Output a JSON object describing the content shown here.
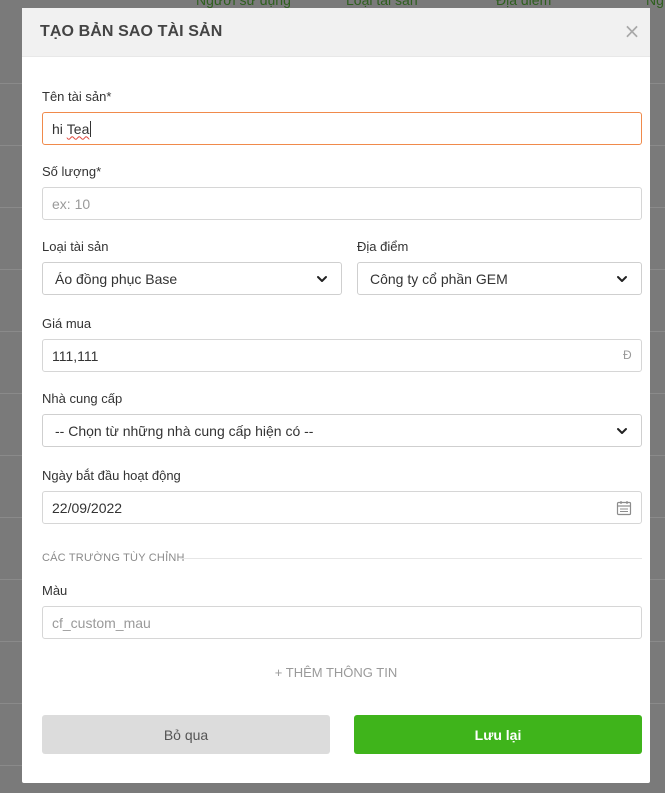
{
  "background": {
    "columns": [
      "Người sử dụng",
      "Loại tài sản",
      "Địa điểm",
      "Ng"
    ]
  },
  "modal": {
    "title": "TẠO BẢN SAO TÀI SẢN",
    "close_label": "×",
    "fields": {
      "asset_name": {
        "label": "Tên tài sản*",
        "value_prefix": "hi ",
        "value_word": "Tea"
      },
      "quantity": {
        "label": "Số lượng*",
        "placeholder": "ex: 10"
      },
      "asset_type": {
        "label": "Loại tài sản",
        "selected": "Áo đồng phục Base"
      },
      "location": {
        "label": "Địa điểm",
        "selected": "Công ty cổ phần GEM"
      },
      "price": {
        "label": "Giá mua",
        "value": "111,111",
        "currency": "Đ"
      },
      "supplier": {
        "label": "Nhà cung cấp",
        "selected": "-- Chọn từ những nhà cung cấp hiện có --"
      },
      "start_date": {
        "label": "Ngày bắt đầu hoạt động",
        "value": "22/09/2022"
      }
    },
    "custom_section": {
      "title": "CÁC TRƯỜNG TÙY CHỈNH",
      "color_field": {
        "label": "Màu",
        "placeholder": "cf_custom_mau"
      }
    },
    "add_more_label": "+ THÊM THÔNG TIN",
    "buttons": {
      "cancel": "Bỏ qua",
      "save": "Lưu lại"
    }
  },
  "colors": {
    "primary_green": "#3fb41b",
    "focus_border": "#f08a4b",
    "header_bg": "#f1f1f1"
  }
}
